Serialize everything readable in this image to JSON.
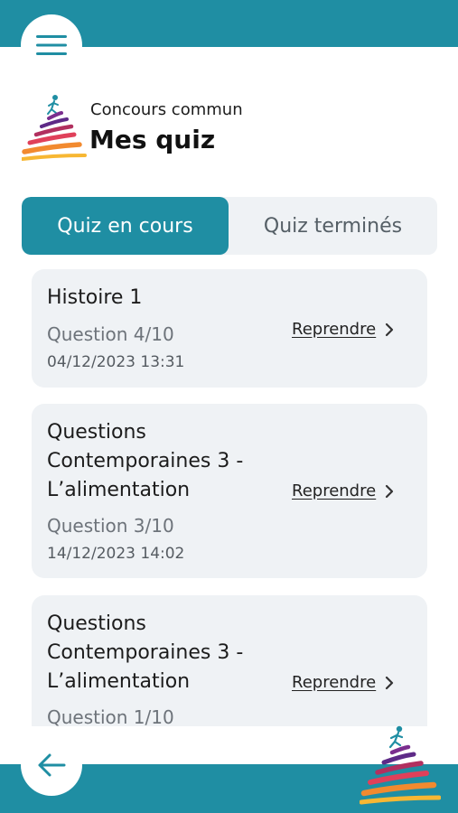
{
  "header": {
    "subtitle": "Concours commun",
    "title": "Mes quiz"
  },
  "tabs": [
    {
      "label": "Quiz en cours",
      "active": true
    },
    {
      "label": "Quiz terminés",
      "active": false
    }
  ],
  "quizzes": [
    {
      "title": "Histoire 1",
      "question": "Question 4/10",
      "date": "04/12/2023 13:31",
      "action": "Reprendre"
    },
    {
      "title": "Questions Contemporaines 3 - L’alimentation",
      "question": "Question 3/10",
      "date": "14/12/2023 14:02",
      "action": "Reprendre"
    },
    {
      "title": "Questions Contemporaines 3 - L’alimentation",
      "question": "Question 1/10",
      "date": "",
      "action": "Reprendre"
    }
  ],
  "icons": {
    "menu": "hamburger-menu-icon",
    "back": "arrow-left-icon",
    "chevron": "chevron-right-icon",
    "logo": "runner-stripes-logo"
  },
  "colors": {
    "primary": "#1f8ea3",
    "card_bg": "#eff2f5"
  }
}
